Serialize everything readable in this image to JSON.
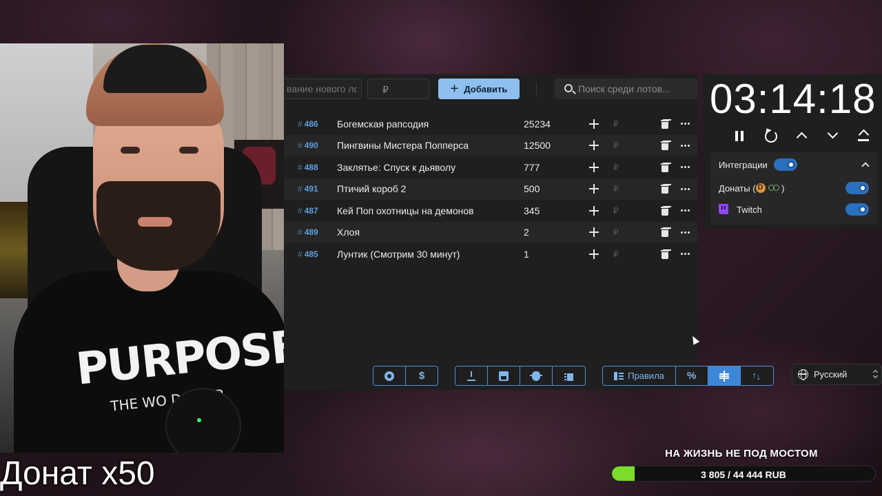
{
  "overlay": {
    "donate_caption": "Донат x50"
  },
  "webcam": {
    "shirt_text": "PURPOSE",
    "shirt_subtext": "THE WO    D TOUR"
  },
  "toolbar": {
    "lot_name_placeholder": "вание нового лот",
    "price_placeholder": "₽",
    "add_label": "Добавить",
    "search_placeholder": "Поиск среди лотов..."
  },
  "lots": [
    {
      "id": "486",
      "name": "Богемская рапсодия",
      "amount": "25234"
    },
    {
      "id": "490",
      "name": "Пингвины Мистера Попперса",
      "amount": "12500"
    },
    {
      "id": "488",
      "name": "Заклятье: Спуск к дьяволу",
      "amount": "777"
    },
    {
      "id": "491",
      "name": "Птичий короб 2",
      "amount": "500"
    },
    {
      "id": "487",
      "name": "Кей Поп охотницы на демонов",
      "amount": "345"
    },
    {
      "id": "489",
      "name": "Хлоя",
      "amount": "2"
    },
    {
      "id": "485",
      "name": "Лунтик (Смотрим 30 минут)",
      "amount": "1"
    }
  ],
  "lot_row": {
    "hash": "#",
    "currency": "₽"
  },
  "bottom_bar": {
    "rules_label": "Правила"
  },
  "timer": {
    "display": "03:14:18"
  },
  "integrations": {
    "title": "Интеграции",
    "enabled": true,
    "items": [
      {
        "label_prefix": "Донаты (",
        "label_suffix": " )",
        "enabled": true
      },
      {
        "label": "Twitch",
        "enabled": true
      }
    ]
  },
  "language": {
    "selected": "Русский"
  },
  "goal": {
    "title": "НА ЖИЗНЬ НЕ ПОД МОСТОМ",
    "progress_text": "3 805 / 44 444 RUB",
    "current": 3805,
    "target": 44444,
    "fill_color": "#7ddb2b"
  },
  "colors": {
    "accent": "#3d86d8",
    "add_button": "#8fbfee",
    "lot_id": "#5e9fe0",
    "twitch": "#9147ff"
  }
}
